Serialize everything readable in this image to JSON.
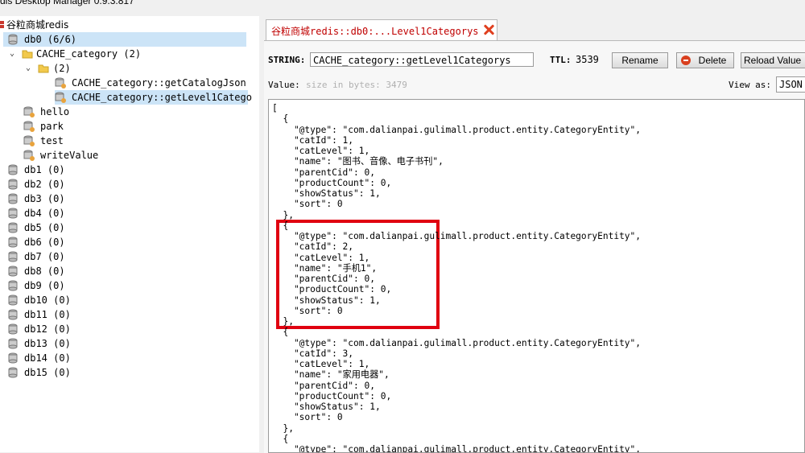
{
  "window": {
    "title": "dis Desktop Manager 0.9.3.817"
  },
  "tree": {
    "connection": "谷粒商城redis",
    "db0": "db0  (6/6)",
    "folder": "CACHE_category (2)",
    "subfolder": "(2)",
    "key1": "CACHE_category::getCatalogJson",
    "key2": "CACHE_category::getLevel1Catego",
    "keys": [
      "hello",
      "park",
      "test",
      "writeValue"
    ],
    "dbs": [
      "db1  (0)",
      "db2  (0)",
      "db3  (0)",
      "db4  (0)",
      "db5  (0)",
      "db6  (0)",
      "db7  (0)",
      "db8  (0)",
      "db9  (0)",
      "db10  (0)",
      "db11  (0)",
      "db12  (0)",
      "db13  (0)",
      "db14  (0)",
      "db15  (0)"
    ]
  },
  "tab": {
    "title": "谷粒商城redis::db0:...Level1Categorys"
  },
  "toolbar": {
    "type_label": "STRING:",
    "key_value": "CACHE_category::getLevel1Categorys",
    "ttl_label": "TTL:",
    "ttl_value": "3539",
    "rename_label": "Rename",
    "delete_label": "Delete",
    "reload_label": "Reload Value"
  },
  "value": {
    "label": "Value:",
    "size_hint": "size in bytes: 3479",
    "view_as_label": "View as:",
    "view_as_value": "JSON"
  },
  "json_lines": [
    "[",
    "  {",
    "    \"@type\": \"com.dalianpai.gulimall.product.entity.CategoryEntity\",",
    "    \"catId\": 1,",
    "    \"catLevel\": 1,",
    "    \"name\": \"图书、音像、电子书刊\",",
    "    \"parentCid\": 0,",
    "    \"productCount\": 0,",
    "    \"showStatus\": 1,",
    "    \"sort\": 0",
    "  },",
    "  {",
    "    \"@type\": \"com.dalianpai.gulimall.product.entity.CategoryEntity\",",
    "    \"catId\": 2,",
    "    \"catLevel\": 1,",
    "    \"name\": \"手机1\",",
    "    \"parentCid\": 0,",
    "    \"productCount\": 0,",
    "    \"showStatus\": 1,",
    "    \"sort\": 0",
    "  },",
    "  {",
    "    \"@type\": \"com.dalianpai.gulimall.product.entity.CategoryEntity\",",
    "    \"catId\": 3,",
    "    \"catLevel\": 1,",
    "    \"name\": \"家用电器\",",
    "    \"parentCid\": 0,",
    "    \"productCount\": 0,",
    "    \"showStatus\": 1,",
    "    \"sort\": 0",
    "  },",
    "  {",
    "    \"@type\": \"com.dalianpai.gulimall.product.entity.CategoryEntity\","
  ],
  "colors": {
    "highlight": "#e00010",
    "selection": "#cce4f7",
    "tab_text": "#c00000"
  }
}
